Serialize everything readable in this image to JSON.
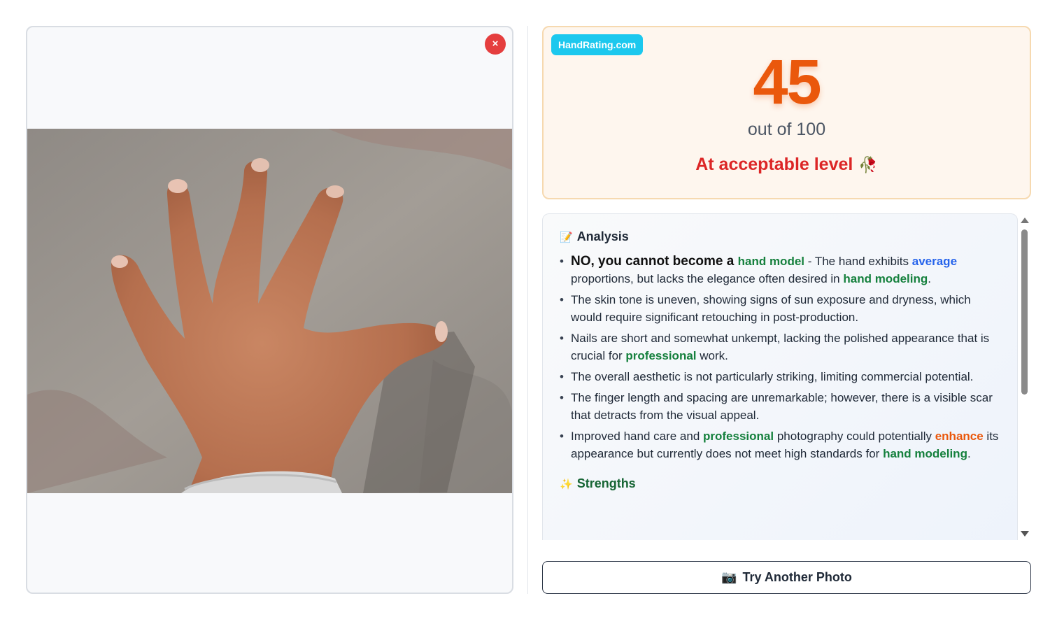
{
  "brand": {
    "badge": "HandRating.com"
  },
  "close": {
    "label": "×"
  },
  "score": {
    "value": "45",
    "out_of": "out of 100",
    "level": "At acceptable level",
    "level_emoji": "🥀"
  },
  "analysis": {
    "title": "Analysis",
    "title_icon": "📝",
    "items": [
      {
        "parts": [
          {
            "t": "NO, you cannot become a ",
            "c": "lead"
          },
          {
            "t": "hand model",
            "c": "hl-green"
          },
          {
            "t": " - The hand exhibits ",
            "c": ""
          },
          {
            "t": "average",
            "c": "hl-blue"
          },
          {
            "t": " proportions, but lacks the elegance often desired in ",
            "c": ""
          },
          {
            "t": "hand modeling",
            "c": "hl-green"
          },
          {
            "t": ".",
            "c": ""
          }
        ]
      },
      {
        "parts": [
          {
            "t": "The skin tone is uneven, showing signs of sun exposure and dryness, which would require significant retouching in post-production.",
            "c": ""
          }
        ]
      },
      {
        "parts": [
          {
            "t": "Nails are short and somewhat unkempt, lacking the polished appearance that is crucial for ",
            "c": ""
          },
          {
            "t": "professional",
            "c": "hl-green"
          },
          {
            "t": " work.",
            "c": ""
          }
        ]
      },
      {
        "parts": [
          {
            "t": "The overall aesthetic is not particularly striking, limiting commercial potential.",
            "c": ""
          }
        ]
      },
      {
        "parts": [
          {
            "t": "The finger length and spacing are unremarkable; however, there is a visible scar that detracts from the visual appeal.",
            "c": ""
          }
        ]
      },
      {
        "parts": [
          {
            "t": "Improved hand care and ",
            "c": ""
          },
          {
            "t": "professional",
            "c": "hl-green"
          },
          {
            "t": " photography could potentially ",
            "c": ""
          },
          {
            "t": "enhance",
            "c": "hl-orange"
          },
          {
            "t": " its appearance but currently does not meet high standards for ",
            "c": ""
          },
          {
            "t": "hand modeling",
            "c": "hl-green"
          },
          {
            "t": ".",
            "c": ""
          }
        ]
      }
    ]
  },
  "strengths": {
    "title": "Strengths",
    "title_icon": "✨"
  },
  "actions": {
    "try_another": "Try Another Photo",
    "try_icon": "📷"
  },
  "colors": {
    "accent_score": "#ea580c",
    "level_text": "#dc2626",
    "brand_badge": "#1cc8ee",
    "close_button": "#e53e3e"
  }
}
